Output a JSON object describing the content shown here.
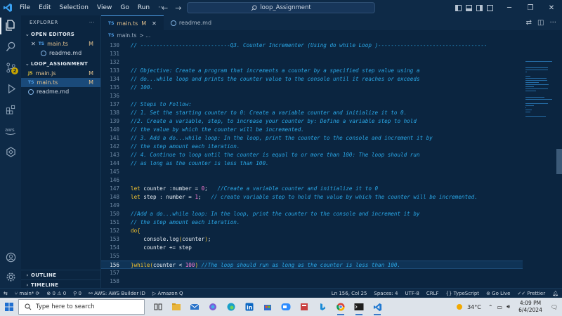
{
  "titlebar": {
    "menu": [
      "File",
      "Edit",
      "Selection",
      "View",
      "Go",
      "Run",
      "···"
    ],
    "command_center": "loop_Assignment"
  },
  "explorer": {
    "title": "EXPLORER",
    "more": "···",
    "open_editors_label": "OPEN EDITORS",
    "open_editors": [
      {
        "name": "main.ts",
        "type": "TS",
        "status": "M"
      },
      {
        "name": "readme.md",
        "type": "info",
        "status": ""
      }
    ],
    "folder_label": "LOOP_ASSIGNMENT",
    "files": [
      {
        "name": "main.js",
        "type": "JS",
        "status": "M"
      },
      {
        "name": "main.ts",
        "type": "TS",
        "status": "M"
      },
      {
        "name": "readme.md",
        "type": "info",
        "status": ""
      }
    ],
    "outline_label": "OUTLINE",
    "timeline_label": "TIMELINE"
  },
  "tabs": [
    {
      "name": "main.ts",
      "type": "TS",
      "status": "M"
    },
    {
      "name": "readme.md",
      "type": "info"
    }
  ],
  "breadcrumb": {
    "type": "TS",
    "file": "main.ts",
    "suffix": "> ..."
  },
  "activity_badge": "2",
  "code": {
    "current_line": 156,
    "lines": [
      {
        "n": 130,
        "t": [
          [
            "cm",
            "// ----------------------------Q3. Counter Incrementer (Using do while Loop )----------------------------------"
          ]
        ]
      },
      {
        "n": 131,
        "t": []
      },
      {
        "n": 132,
        "t": []
      },
      {
        "n": 133,
        "t": [
          [
            "cm",
            "// Objective: Create a program that increments a counter by a specified step value using a"
          ]
        ]
      },
      {
        "n": 134,
        "t": [
          [
            "cm",
            "// do...while loop and prints the counter value to the console until it reaches or exceeds"
          ]
        ]
      },
      {
        "n": 135,
        "t": [
          [
            "cm",
            "// 100."
          ]
        ]
      },
      {
        "n": 136,
        "t": []
      },
      {
        "n": 137,
        "t": [
          [
            "cm",
            "// Steps to Follow:"
          ]
        ]
      },
      {
        "n": 138,
        "t": [
          [
            "cm",
            "// 1. Set the starting counter to 0: Create a variable counter and initialize it to 0."
          ]
        ]
      },
      {
        "n": 139,
        "t": [
          [
            "cm",
            "//2. Create a variable, step, to increase your counter by: Define a variable step to hold"
          ]
        ]
      },
      {
        "n": 140,
        "t": [
          [
            "cm",
            "// the value by which the counter will be incremented."
          ]
        ]
      },
      {
        "n": 141,
        "t": [
          [
            "cm",
            "// 3. Add a do...while loop: In the loop, print the counter to the console and increment it by"
          ]
        ]
      },
      {
        "n": 142,
        "t": [
          [
            "cm",
            "// the step amount each iteration."
          ]
        ]
      },
      {
        "n": 143,
        "t": [
          [
            "cm",
            "// 4. Continue to loop until the counter is equal to or more than 100: The loop should run"
          ]
        ]
      },
      {
        "n": 144,
        "t": [
          [
            "cm",
            "// as long as the counter is less than 100."
          ]
        ]
      },
      {
        "n": 145,
        "t": []
      },
      {
        "n": 146,
        "t": []
      },
      {
        "n": 147,
        "t": [
          [
            "kw",
            "let"
          ],
          [
            "pl",
            " counter :number = "
          ],
          [
            "num",
            "0"
          ],
          [
            "pl",
            ";   "
          ],
          [
            "cm",
            "//Create a variable counter and initialize it to 0"
          ]
        ]
      },
      {
        "n": 148,
        "t": [
          [
            "kw",
            "let"
          ],
          [
            "pl",
            " step : number = "
          ],
          [
            "num",
            "1"
          ],
          [
            "pl",
            ";   "
          ],
          [
            "cm",
            "// create variable step to hold the value by which the counter will be incremented."
          ]
        ]
      },
      {
        "n": 149,
        "t": []
      },
      {
        "n": 150,
        "t": [
          [
            "cm",
            "//Add a do...while loop: In the loop, print the counter to the console and increment it by"
          ]
        ]
      },
      {
        "n": 151,
        "t": [
          [
            "cm",
            "// the step amount each iteration."
          ]
        ]
      },
      {
        "n": 152,
        "t": [
          [
            "kw",
            "do"
          ],
          [
            "kw",
            "{"
          ]
        ]
      },
      {
        "n": 153,
        "t": [
          [
            "pl",
            "    console."
          ],
          [
            "fn",
            "log"
          ],
          [
            "kw",
            "("
          ],
          [
            "pl",
            "counter"
          ],
          [
            "kw",
            ")"
          ],
          [
            "pl",
            ";"
          ]
        ]
      },
      {
        "n": 154,
        "t": [
          [
            "pl",
            "    counter += step"
          ]
        ]
      },
      {
        "n": 155,
        "t": []
      },
      {
        "n": 156,
        "t": [
          [
            "kw",
            "}"
          ],
          [
            "kw",
            "while"
          ],
          [
            "kw",
            "("
          ],
          [
            "pl",
            "counter < "
          ],
          [
            "num",
            "100"
          ],
          [
            "kw",
            ")"
          ],
          [
            "pl",
            " "
          ],
          [
            "cm",
            "//The loop should run as long as the counter is less than 100."
          ]
        ]
      },
      {
        "n": 157,
        "t": []
      },
      {
        "n": 158,
        "t": []
      }
    ]
  },
  "status": {
    "branch": "main*",
    "errors": "0",
    "warnings": "0",
    "info": "0",
    "aws": "AWS: AWS Builder ID",
    "amazon_q": "Amazon Q",
    "position": "Ln 156, Col 25",
    "spaces": "Spaces: 4",
    "encoding": "UTF-8",
    "eol": "CRLF",
    "language": "TypeScript",
    "golive": "Go Live",
    "prettier": "Prettier"
  },
  "taskbar": {
    "search_placeholder": "Type here to search",
    "temperature": "34°C",
    "time": "4:09 PM",
    "date": "6/4/2024"
  },
  "colors": {
    "background": "#0b2540",
    "comment": "#2aa7e6",
    "keyword": "#f4c430",
    "number": "#ff7bd5",
    "modified": "#e2c08d"
  }
}
